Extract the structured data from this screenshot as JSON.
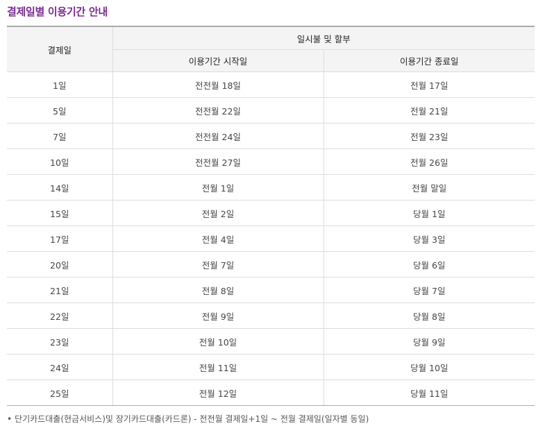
{
  "title": "결제일별 이용기간 안내",
  "table": {
    "header_payment_day": "결제일",
    "header_group": "일시불 및 할부",
    "header_start": "이용기간 시작일",
    "header_end": "이용기간 종료일",
    "rows": [
      {
        "day": "1일",
        "start": "전전월 18일",
        "end": "전월 17일"
      },
      {
        "day": "5일",
        "start": "전전월 22일",
        "end": "전월 21일"
      },
      {
        "day": "7일",
        "start": "전전월 24일",
        "end": "전월 23일"
      },
      {
        "day": "10일",
        "start": "전전월 27일",
        "end": "전월 26일"
      },
      {
        "day": "14일",
        "start": "전월 1일",
        "end": "전월 말일"
      },
      {
        "day": "15일",
        "start": "전월 2일",
        "end": "당월 1일"
      },
      {
        "day": "17일",
        "start": "전월 4일",
        "end": "당월 3일"
      },
      {
        "day": "20일",
        "start": "전월 7일",
        "end": "당월 6일"
      },
      {
        "day": "21일",
        "start": "전월 8일",
        "end": "당월 7일"
      },
      {
        "day": "22일",
        "start": "전월 9일",
        "end": "당월 8일"
      },
      {
        "day": "23일",
        "start": "전월 10일",
        "end": "당월 9일"
      },
      {
        "day": "24일",
        "start": "전월 11일",
        "end": "당월 10일"
      },
      {
        "day": "25일",
        "start": "전월 12일",
        "end": "당월 11일"
      }
    ]
  },
  "note": {
    "bullet": "•",
    "text": "단기카드대출(현금서비스)및 장기카드대출(카드론) - 전전월 결제일+1일 ~ 전월 결제일(일자별 동일)"
  },
  "colors": {
    "title": "#7b2b97",
    "header_bg": "#f4f4f4",
    "border": "#dcdcdc"
  }
}
